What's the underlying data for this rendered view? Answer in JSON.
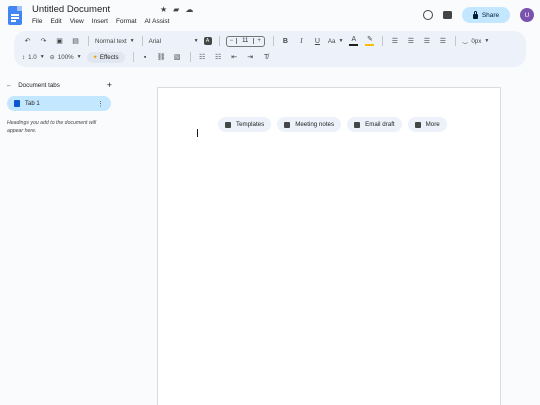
{
  "app": {
    "title": "Untitled Document",
    "title_icons": [
      "star-icon",
      "folder-move-icon",
      "cloud-done-icon"
    ]
  },
  "menu": [
    "File",
    "Edit",
    "View",
    "Insert",
    "Format",
    "AI Assist"
  ],
  "header_right": {
    "history_icon": "history-icon",
    "comments_icon": "comment-icon",
    "share_label": "Share",
    "avatar_initial": "U",
    "avatar_color": "#7b52ae"
  },
  "toolbar": {
    "style_dropdown": "Normal text",
    "font_dropdown": "Arial",
    "font_size": "11",
    "decrease": "−",
    "increase": "+",
    "bold": "B",
    "italic": "I",
    "underline": "U",
    "text_case": "Aa",
    "text_color_glyph": "A",
    "spacing_value": "0px",
    "line_spacing": "1.0",
    "zoom": "100%",
    "effects_label": "Effects"
  },
  "sidebar": {
    "heading": "Document tabs",
    "tab_label": "Tab 1",
    "note": "Headings you add to the document will appear here."
  },
  "page": {
    "chips": [
      {
        "label": "Templates",
        "icon": "template-icon"
      },
      {
        "label": "Meeting notes",
        "icon": "calendar-icon"
      },
      {
        "label": "Email draft",
        "icon": "email-icon"
      },
      {
        "label": "More",
        "icon": "plus-box-icon"
      }
    ]
  },
  "colors": {
    "accent": "#0b57d0",
    "share_bg": "#c2e7ff",
    "toolbar_bg": "#edf2fa",
    "doc_blue": "#4285f4",
    "highlight_yellow": "#fbbc04"
  }
}
